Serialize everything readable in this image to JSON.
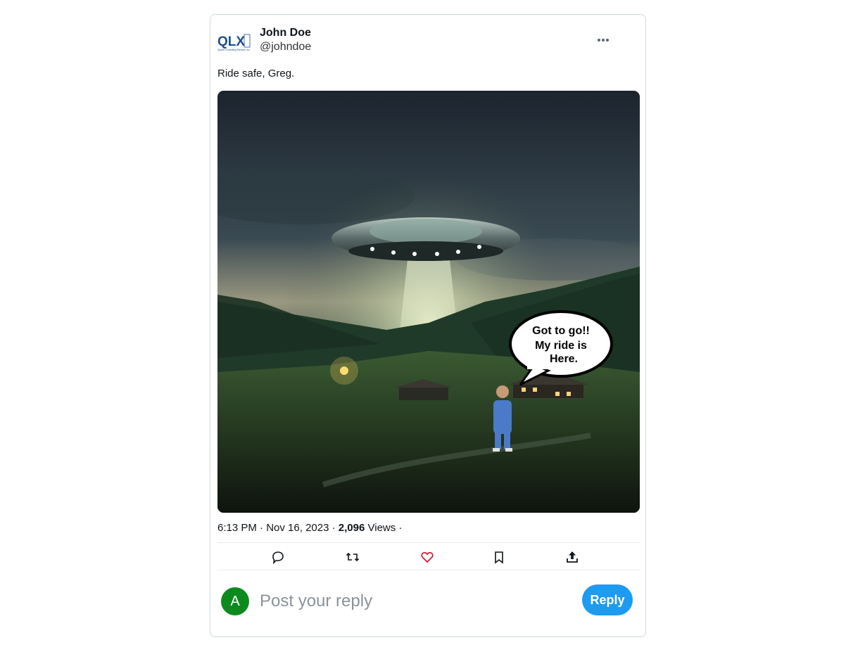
{
  "author": {
    "logo_text": "QLX",
    "logo_sub": "Quarter Consulting Services, Inc.",
    "display_name": "John Doe",
    "handle": "@johndoe"
  },
  "tweet": {
    "text": "Ride safe, Greg.",
    "media": {
      "speech_bubble_lines": [
        "Got to go!!",
        "My ride is",
        "Here."
      ]
    },
    "meta": {
      "time": "6:13 PM",
      "sep1": " · ",
      "date": "Nov 16, 2023",
      "sep2": " · ",
      "views_count": "2,096",
      "views_label": " Views",
      "sep3": " ·"
    }
  },
  "actions": [
    {
      "icon": "reply-icon"
    },
    {
      "icon": "retweet-icon"
    },
    {
      "icon": "like-icon",
      "color": "#d0112b"
    },
    {
      "icon": "bookmark-icon"
    },
    {
      "icon": "share-icon"
    }
  ],
  "composer": {
    "avatar_letter": "A",
    "avatar_color": "#0d8a1e",
    "placeholder": "Post your reply",
    "button_label": "Reply",
    "button_color": "#1d9bf0"
  }
}
